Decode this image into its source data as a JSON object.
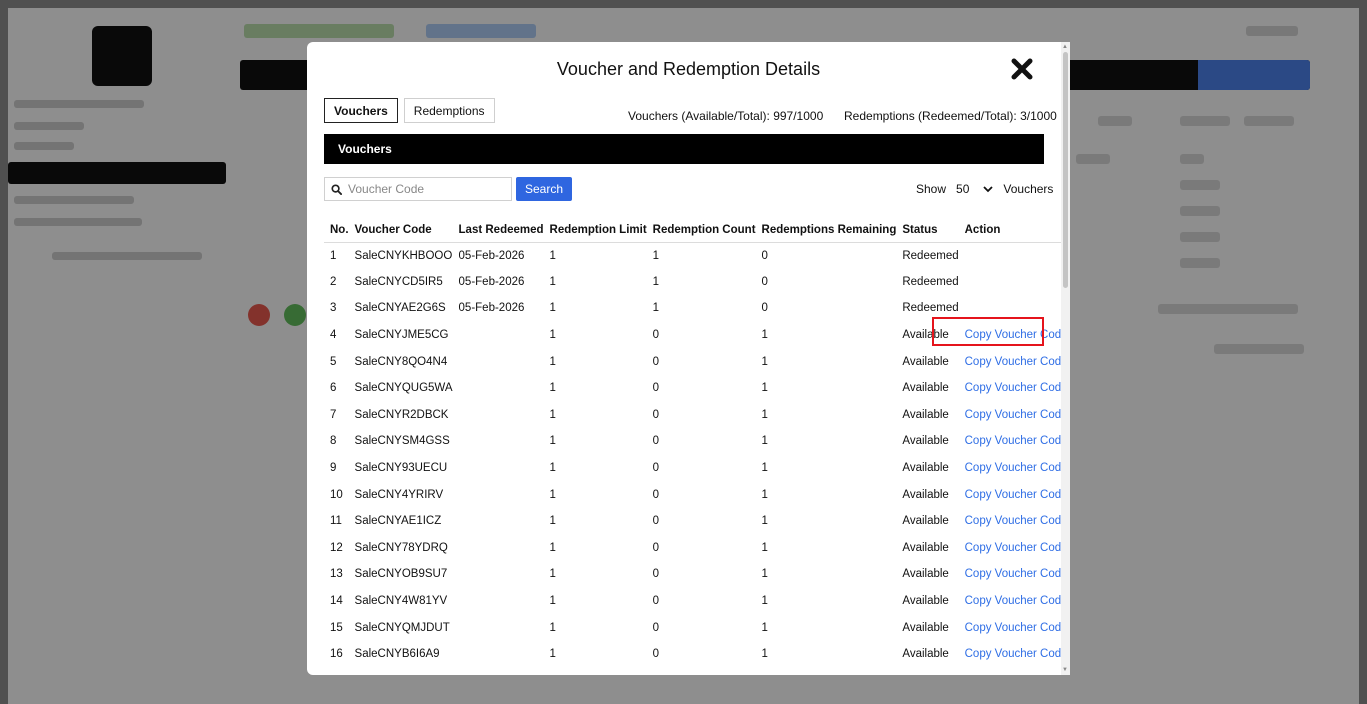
{
  "modal": {
    "title": "Voucher and Redemption Details",
    "close_icon": "close-icon"
  },
  "tabs": [
    {
      "label": "Vouchers",
      "active": true
    },
    {
      "label": "Redemptions",
      "active": false
    }
  ],
  "summary": {
    "vouchers": "Vouchers (Available/Total): 997/1000",
    "redemptions": "Redemptions (Redeemed/Total): 3/1000"
  },
  "section": {
    "title": "Vouchers"
  },
  "search": {
    "placeholder": "Voucher Code",
    "button_label": "Search",
    "icon": "search-icon"
  },
  "show": {
    "prefix": "Show",
    "value": "50",
    "suffix": "Vouchers"
  },
  "table": {
    "columns": [
      "No.",
      "Voucher Code",
      "Last Redeemed",
      "Redemption Limit",
      "Redemption Count",
      "Redemptions Remaining",
      "Status",
      "Action"
    ],
    "rows": [
      {
        "no": "1",
        "code": "SaleCNYKHBOOO",
        "last": "05-Feb-2026",
        "limit": "1",
        "count": "1",
        "remaining": "0",
        "status": "Redeemed",
        "action": ""
      },
      {
        "no": "2",
        "code": "SaleCNYCD5IR5",
        "last": "05-Feb-2026",
        "limit": "1",
        "count": "1",
        "remaining": "0",
        "status": "Redeemed",
        "action": ""
      },
      {
        "no": "3",
        "code": "SaleCNYAE2G6S",
        "last": "05-Feb-2026",
        "limit": "1",
        "count": "1",
        "remaining": "0",
        "status": "Redeemed",
        "action": ""
      },
      {
        "no": "4",
        "code": "SaleCNYJME5CG",
        "last": "",
        "limit": "1",
        "count": "0",
        "remaining": "1",
        "status": "Available",
        "action": "Copy Voucher Code"
      },
      {
        "no": "5",
        "code": "SaleCNY8QO4N4",
        "last": "",
        "limit": "1",
        "count": "0",
        "remaining": "1",
        "status": "Available",
        "action": "Copy Voucher Code"
      },
      {
        "no": "6",
        "code": "SaleCNYQUG5WA",
        "last": "",
        "limit": "1",
        "count": "0",
        "remaining": "1",
        "status": "Available",
        "action": "Copy Voucher Code"
      },
      {
        "no": "7",
        "code": "SaleCNYR2DBCK",
        "last": "",
        "limit": "1",
        "count": "0",
        "remaining": "1",
        "status": "Available",
        "action": "Copy Voucher Code"
      },
      {
        "no": "8",
        "code": "SaleCNYSM4GSS",
        "last": "",
        "limit": "1",
        "count": "0",
        "remaining": "1",
        "status": "Available",
        "action": "Copy Voucher Code"
      },
      {
        "no": "9",
        "code": "SaleCNY93UECU",
        "last": "",
        "limit": "1",
        "count": "0",
        "remaining": "1",
        "status": "Available",
        "action": "Copy Voucher Code"
      },
      {
        "no": "10",
        "code": "SaleCNY4YRIRV",
        "last": "",
        "limit": "1",
        "count": "0",
        "remaining": "1",
        "status": "Available",
        "action": "Copy Voucher Code"
      },
      {
        "no": "11",
        "code": "SaleCNYAE1ICZ",
        "last": "",
        "limit": "1",
        "count": "0",
        "remaining": "1",
        "status": "Available",
        "action": "Copy Voucher Code"
      },
      {
        "no": "12",
        "code": "SaleCNY78YDRQ",
        "last": "",
        "limit": "1",
        "count": "0",
        "remaining": "1",
        "status": "Available",
        "action": "Copy Voucher Code"
      },
      {
        "no": "13",
        "code": "SaleCNYOB9SU7",
        "last": "",
        "limit": "1",
        "count": "0",
        "remaining": "1",
        "status": "Available",
        "action": "Copy Voucher Code"
      },
      {
        "no": "14",
        "code": "SaleCNY4W81YV",
        "last": "",
        "limit": "1",
        "count": "0",
        "remaining": "1",
        "status": "Available",
        "action": "Copy Voucher Code"
      },
      {
        "no": "15",
        "code": "SaleCNYQMJDUT",
        "last": "",
        "limit": "1",
        "count": "0",
        "remaining": "1",
        "status": "Available",
        "action": "Copy Voucher Code"
      },
      {
        "no": "16",
        "code": "SaleCNYB6I6A9",
        "last": "",
        "limit": "1",
        "count": "0",
        "remaining": "1",
        "status": "Available",
        "action": "Copy Voucher Code"
      }
    ]
  },
  "colors": {
    "accent": "#2f66e0",
    "link": "#2f6ee5",
    "highlight": "#e5141c",
    "bar": "#000000"
  }
}
